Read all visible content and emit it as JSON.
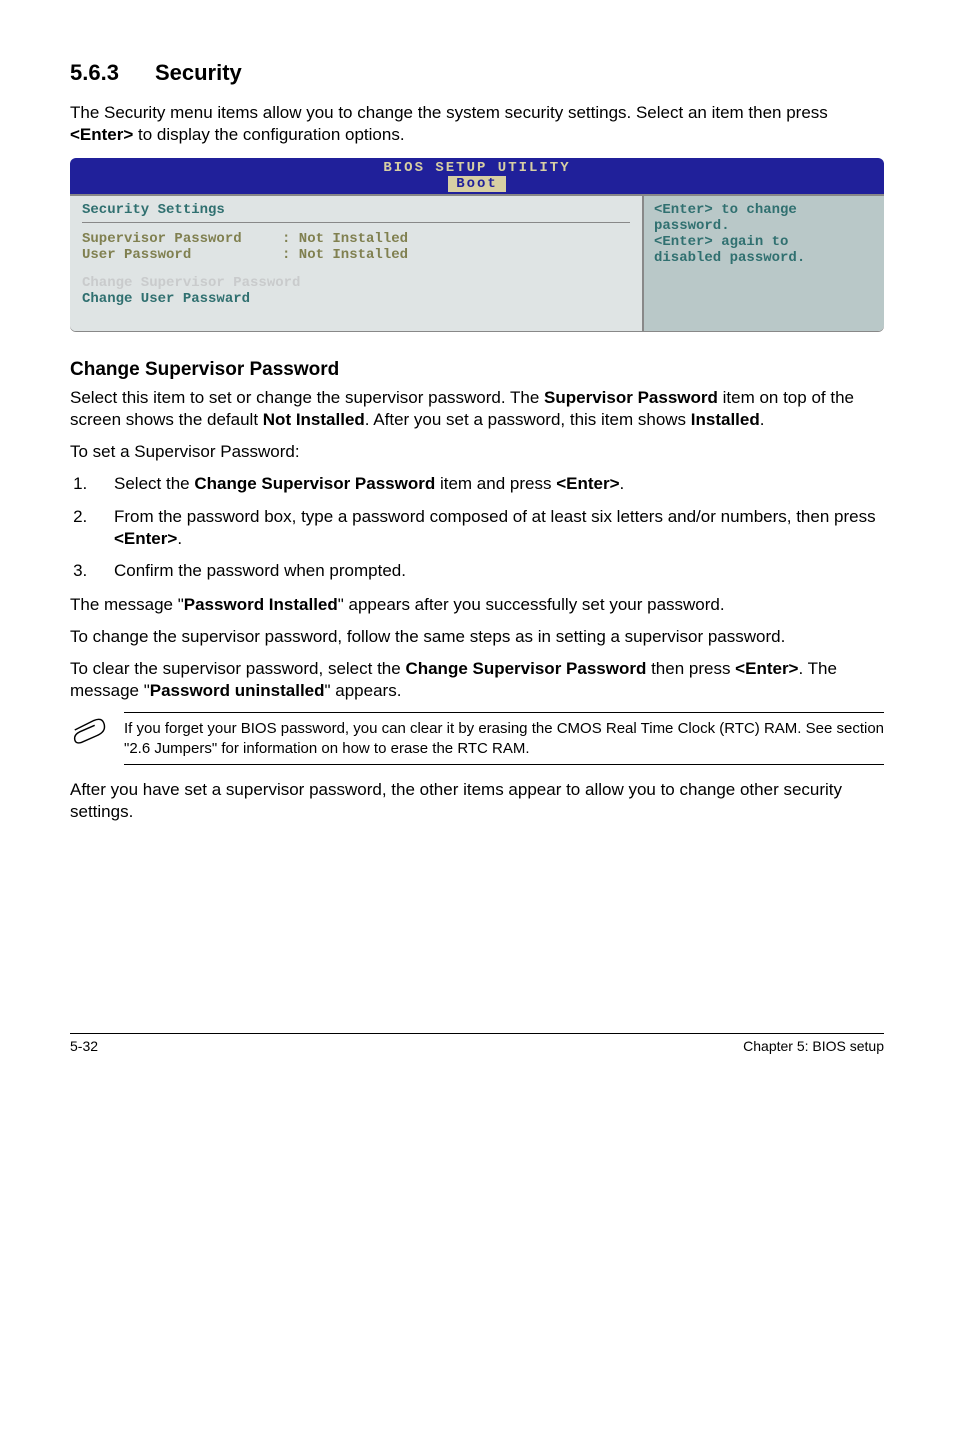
{
  "section": {
    "number": "5.6.3",
    "title": "Security"
  },
  "intro": "The Security menu items allow you to change the system security settings. Select an item then press <Enter> to display the configuration options.",
  "intro_pre": "The Security menu items allow you to change the system security settings. Select an item then press ",
  "intro_enter": "<Enter>",
  "intro_post": " to display the configuration options.",
  "bios": {
    "title": "BIOS SETUP UTILITY",
    "tab": "Boot",
    "left": {
      "heading": "Security Settings",
      "row1_label": "Supervisor Password",
      "row1_value": ": Not Installed",
      "row2_label": "User Password",
      "row2_value": ": Not Installed",
      "change1": "Change Supervisor Password",
      "change2": "Change User Passward"
    },
    "right": {
      "l1": "<Enter> to change",
      "l2": "password.",
      "l3": "<Enter> again to",
      "l4": "disabled password."
    }
  },
  "subhead": "Change Supervisor Password",
  "para1_a": "Select this item to set or change the supervisor password. The ",
  "para1_b": "Supervisor Password",
  "para1_c": " item on top of the screen shows the default ",
  "para1_d": "Not Installed",
  "para1_e": ". After you set a password, this item shows ",
  "para1_f": "Installed",
  "para1_g": ".",
  "para2": "To set a Supervisor Password:",
  "list": {
    "i1_a": "Select the ",
    "i1_b": "Change Supervisor Password",
    "i1_c": " item and press ",
    "i1_d": "<Enter>",
    "i1_e": ".",
    "i2_a": "From the password box, type a password composed of at least six letters and/or numbers, then press ",
    "i2_b": "<Enter>",
    "i2_c": ".",
    "i3": "Confirm the password when prompted."
  },
  "para3_a": "The message \"",
  "para3_b": "Password Installed",
  "para3_c": "\" appears after you successfully set your password.",
  "para4": "To change the supervisor password, follow the same steps as in setting a supervisor password.",
  "para5_a": "To clear the supervisor password, select the ",
  "para5_b": "Change Supervisor Password",
  "para5_c": " then press ",
  "para5_d": "<Enter>",
  "para5_e": ". The message \"",
  "para5_f": "Password uninstalled",
  "para5_g": "\" appears.",
  "note": "If you forget your BIOS password, you can clear it by erasing the CMOS Real Time Clock (RTC) RAM. See section \"2.6 Jumpers\" for information on how to erase the RTC RAM.",
  "para6": "After you have set a supervisor password, the other items appear to allow you to change other security settings.",
  "footer": {
    "page": "5-32",
    "chapter": "Chapter 5: BIOS setup"
  }
}
